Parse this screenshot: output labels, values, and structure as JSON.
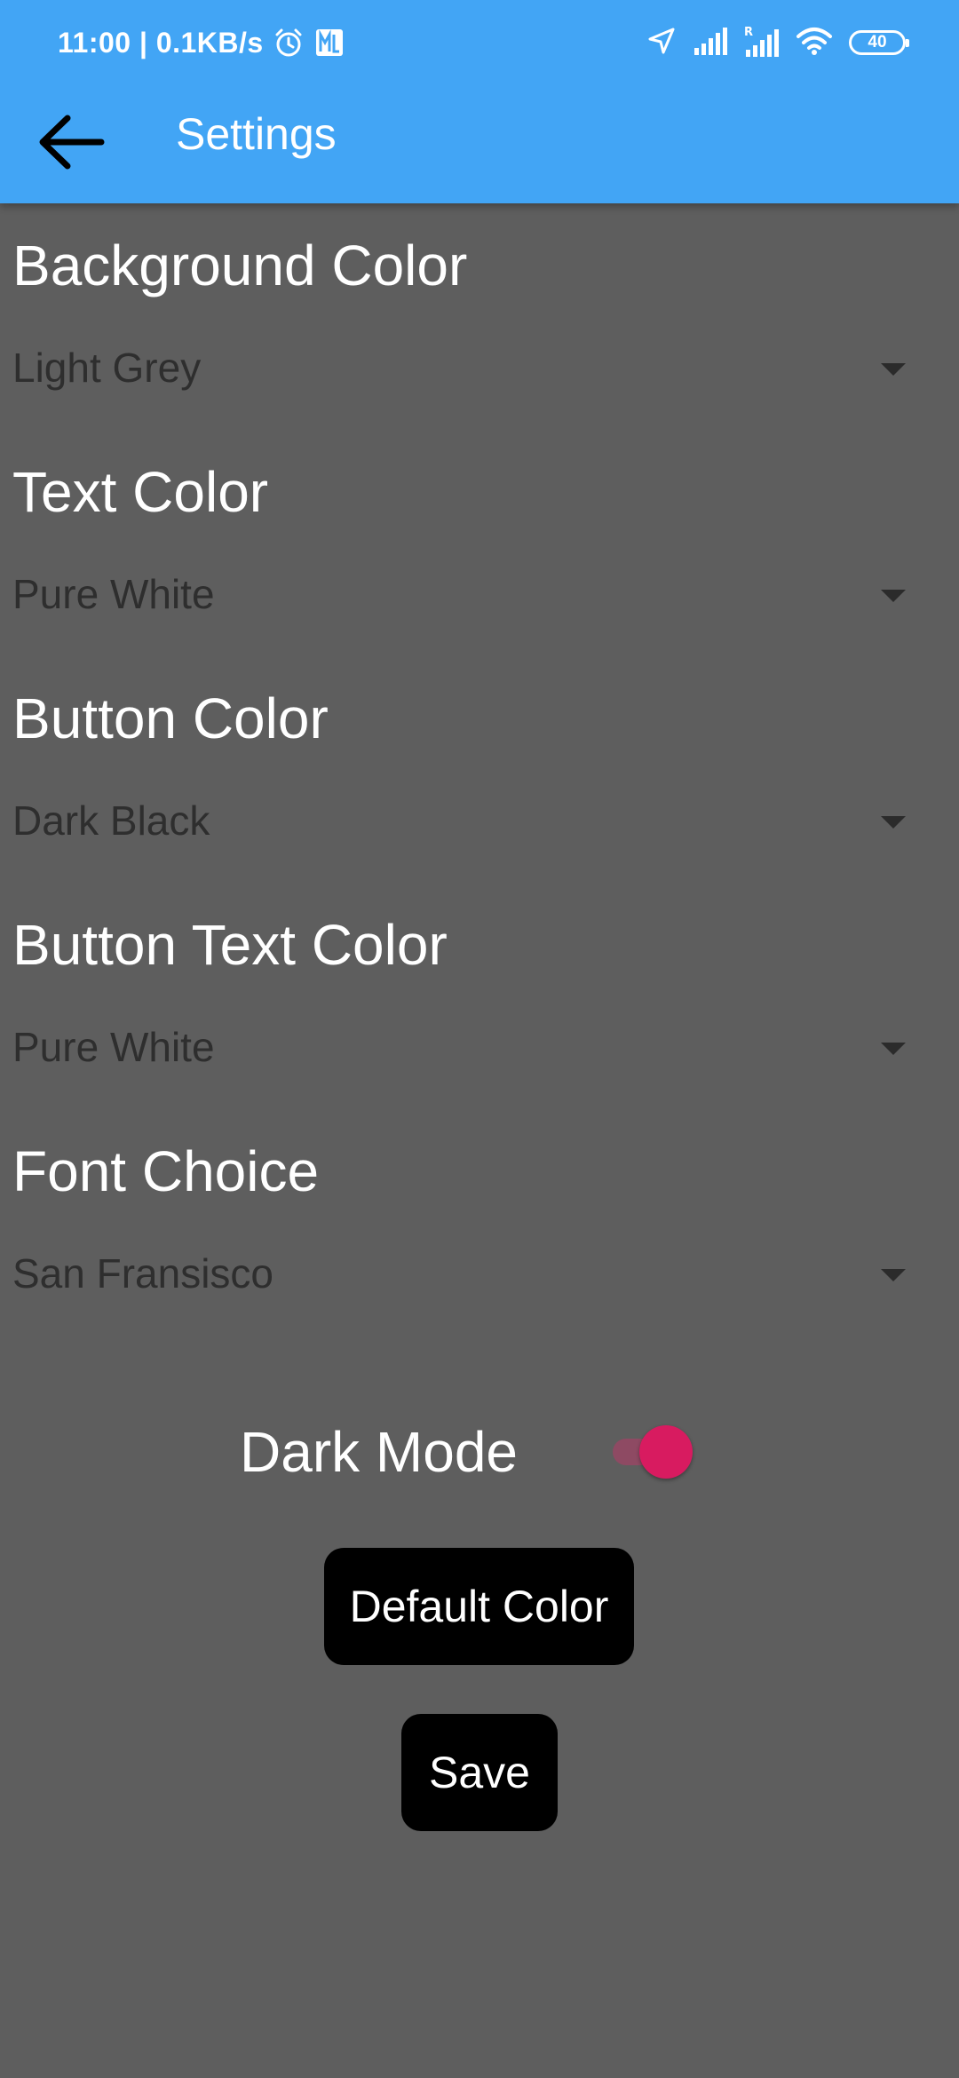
{
  "status_bar": {
    "time_speed": "11:00 | 0.1KB/s",
    "battery": "40",
    "icons": [
      "alarm-icon",
      "app-notification-icon",
      "location-arrow-icon",
      "signal-icon",
      "roaming-signal-icon",
      "wifi-icon",
      "battery-icon"
    ]
  },
  "app_bar": {
    "title": "Settings",
    "back_icon": "arrow-left-icon",
    "color": "#42A5F5"
  },
  "settings": [
    {
      "label": "Background Color",
      "value": "Light Grey"
    },
    {
      "label": "Text Color",
      "value": "Pure White"
    },
    {
      "label": "Button Color",
      "value": "Dark Black"
    },
    {
      "label": "Button Text Color",
      "value": "Pure White"
    },
    {
      "label": "Font Choice",
      "value": "San Fransisco"
    }
  ],
  "dark_mode": {
    "label": "Dark Mode",
    "on": true,
    "accent": "#D81B60"
  },
  "buttons": {
    "default_color": "Default Color",
    "save": "Save"
  },
  "colors": {
    "background": "#5E5E5E",
    "text": "#FFFFFF",
    "button": "#000000",
    "dropdown_text": "#2E2E2E"
  }
}
